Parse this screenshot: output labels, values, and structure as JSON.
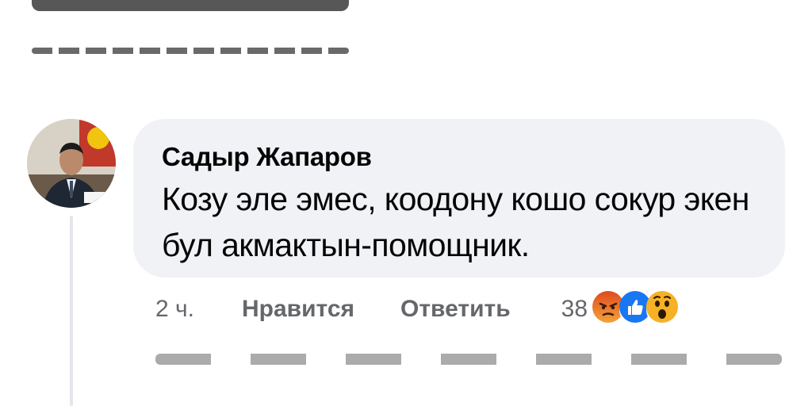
{
  "comment": {
    "author": "Садыр Жапаров",
    "text": "Козу эле эмес, коодону кошо сокур экен бул акмактын-помощник.",
    "time": "2 ч.",
    "like_label": "Нравится",
    "reply_label": "Ответить",
    "reaction_count": "38",
    "reactions": [
      "angry-reaction-icon",
      "like-reaction-icon",
      "wow-reaction-icon"
    ]
  },
  "colors": {
    "bubble": "#f0f2f5",
    "meta_text": "#65676b",
    "like_blue": "#1877f2",
    "angry": "#e9710f",
    "wow": "#f7b125"
  }
}
